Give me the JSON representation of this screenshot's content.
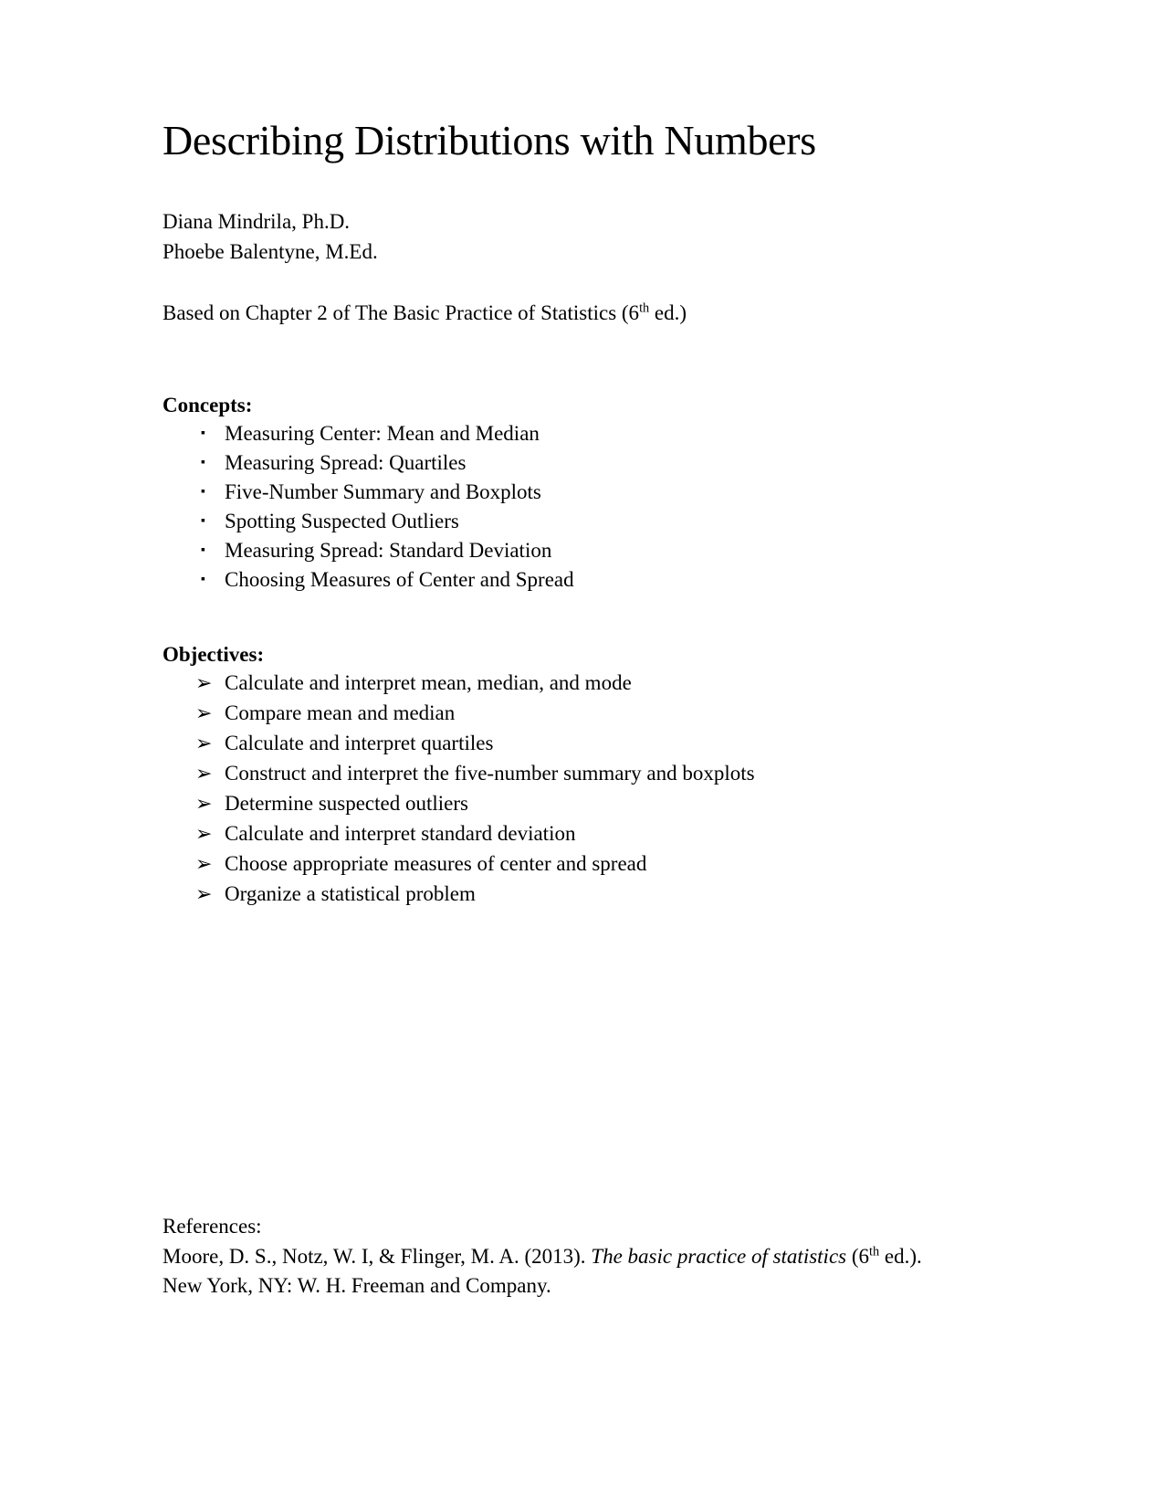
{
  "document": {
    "title": "Describing Distributions with Numbers",
    "authors": [
      "Diana Mindrila, Ph.D.",
      "Phoebe Balentyne, M.Ed."
    ],
    "source_attribution": {
      "prefix": "Based on Chapter 2 of The Basic Practice of Statistics (6",
      "ordinal_suffix": "th",
      "suffix": " ed.)"
    },
    "concepts": {
      "heading": "Concepts:",
      "bullet_glyph": "▪",
      "bullet_icon_name": "square-bullet-icon",
      "items": [
        "Measuring Center: Mean and Median",
        "Measuring Spread: Quartiles",
        "Five-Number Summary and Boxplots",
        "Spotting Suspected Outliers",
        "Measuring Spread: Standard Deviation",
        "Choosing Measures of Center and Spread"
      ]
    },
    "objectives": {
      "heading": "Objectives:",
      "bullet_glyph": "➢",
      "bullet_icon_name": "arrow-bullet-icon",
      "items": [
        "Calculate and interpret mean, median, and mode",
        "Compare mean and median",
        "Calculate and interpret quartiles",
        "Construct and interpret the five-number summary and boxplots",
        "Determine suspected outliers",
        "Calculate and interpret standard deviation",
        "Choose appropriate measures of center and spread",
        "Organize a statistical problem"
      ]
    },
    "references": {
      "label": "References:",
      "entry_part1": "Moore, D. S., Notz, W. I, & Flinger, M. A. (2013). ",
      "entry_italic": "The basic practice of statistics",
      "entry_part2": " (6",
      "entry_ordinal": "th",
      "entry_part3": " ed.). New York, NY: W. H. Freeman and Company."
    }
  },
  "colors": {
    "page_background": "#ffffff",
    "text": "#000000"
  }
}
